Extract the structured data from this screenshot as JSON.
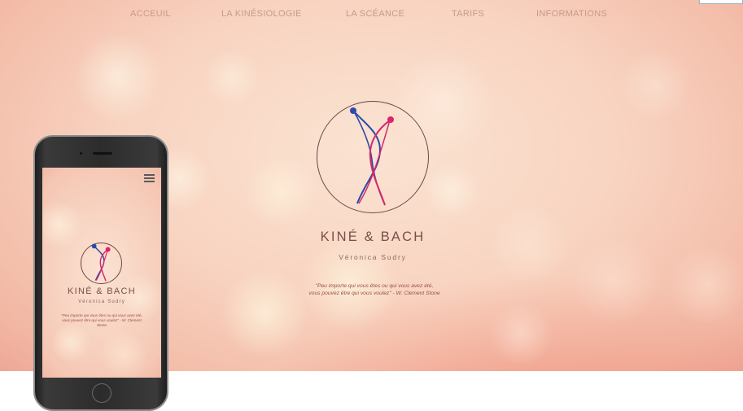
{
  "nav": {
    "items": [
      {
        "label": "ACCEUIL"
      },
      {
        "label": "LA KINÉSIOLOGIE"
      },
      {
        "label": "LA SCÉANCE"
      },
      {
        "label": "TARIFS"
      },
      {
        "label": "INFORMATIONS"
      }
    ]
  },
  "hero": {
    "title": "KINÉ & BACH",
    "subtitle": "Véronica Sudry",
    "quote_line1": "\"Peu  importe qui vous êtes ou qui vous avez été,",
    "quote_line2": "vous  pouvez  être qui vous voulez\" - W. Clement Stone"
  },
  "mobile": {
    "title": "KINÉ & BACH",
    "subtitle": "Véronica Sudry",
    "quote": "\"Peu  importe qui vous êtes ou qui vous avez été, vous  pouvez  être qui vous voulez\" - W. Clement Stone",
    "menu_icon": "hamburger-menu-icon"
  },
  "colors": {
    "logo_blue": "#2b4aa8",
    "logo_pink": "#e0226a",
    "text_brown": "#7a4f4a",
    "nav_text": "#c9998a"
  }
}
